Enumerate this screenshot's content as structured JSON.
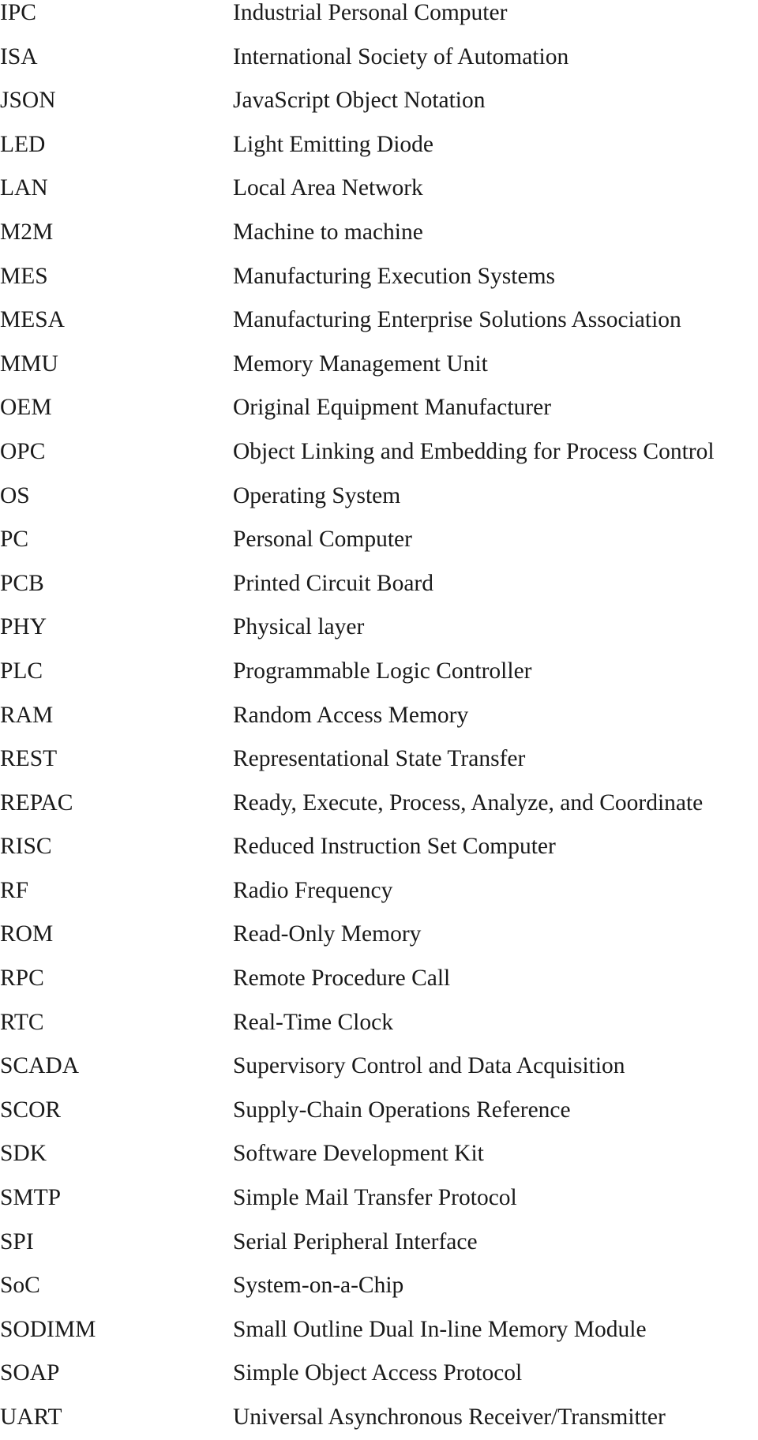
{
  "abbreviations": [
    {
      "abbr": "IPC",
      "definition": "Industrial Personal Computer"
    },
    {
      "abbr": "ISA",
      "definition": "International Society of Automation"
    },
    {
      "abbr": "JSON",
      "definition": "JavaScript Object Notation"
    },
    {
      "abbr": "LED",
      "definition": "Light Emitting Diode"
    },
    {
      "abbr": "LAN",
      "definition": "Local Area Network"
    },
    {
      "abbr": "M2M",
      "definition": "Machine to machine"
    },
    {
      "abbr": "MES",
      "definition": "Manufacturing Execution Systems"
    },
    {
      "abbr": "MESA",
      "definition": "Manufacturing Enterprise Solutions Association"
    },
    {
      "abbr": "MMU",
      "definition": "Memory Management Unit"
    },
    {
      "abbr": "OEM",
      "definition": "Original Equipment Manufacturer"
    },
    {
      "abbr": "OPC",
      "definition": "Object Linking and Embedding for Process Control"
    },
    {
      "abbr": "OS",
      "definition": "Operating System"
    },
    {
      "abbr": "PC",
      "definition": "Personal Computer"
    },
    {
      "abbr": "PCB",
      "definition": "Printed Circuit Board"
    },
    {
      "abbr": "PHY",
      "definition": "Physical layer"
    },
    {
      "abbr": "PLC",
      "definition": "Programmable Logic Controller"
    },
    {
      "abbr": "RAM",
      "definition": "Random Access Memory"
    },
    {
      "abbr": "REST",
      "definition": "Representational State Transfer"
    },
    {
      "abbr": "REPAC",
      "definition": "Ready, Execute, Process, Analyze, and Coordinate"
    },
    {
      "abbr": "RISC",
      "definition": "Reduced Instruction Set Computer"
    },
    {
      "abbr": "RF",
      "definition": "Radio Frequency"
    },
    {
      "abbr": "ROM",
      "definition": "Read-Only Memory"
    },
    {
      "abbr": "RPC",
      "definition": "Remote Procedure Call"
    },
    {
      "abbr": "RTC",
      "definition": "Real-Time Clock"
    },
    {
      "abbr": "SCADA",
      "definition": "Supervisory Control and Data Acquisition"
    },
    {
      "abbr": "SCOR",
      "definition": "Supply-Chain Operations Reference"
    },
    {
      "abbr": "SDK",
      "definition": "Software Development Kit"
    },
    {
      "abbr": "SMTP",
      "definition": "Simple Mail Transfer Protocol"
    },
    {
      "abbr": "SPI",
      "definition": "Serial Peripheral Interface"
    },
    {
      "abbr": "SoC",
      "definition": "System-on-a-Chip"
    },
    {
      "abbr": "SODIMM",
      "definition": "Small Outline Dual In-line Memory Module"
    },
    {
      "abbr": "SOAP",
      "definition": "Simple Object Access Protocol"
    },
    {
      "abbr": "UART",
      "definition": "Universal Asynchronous Receiver/Transmitter"
    }
  ]
}
